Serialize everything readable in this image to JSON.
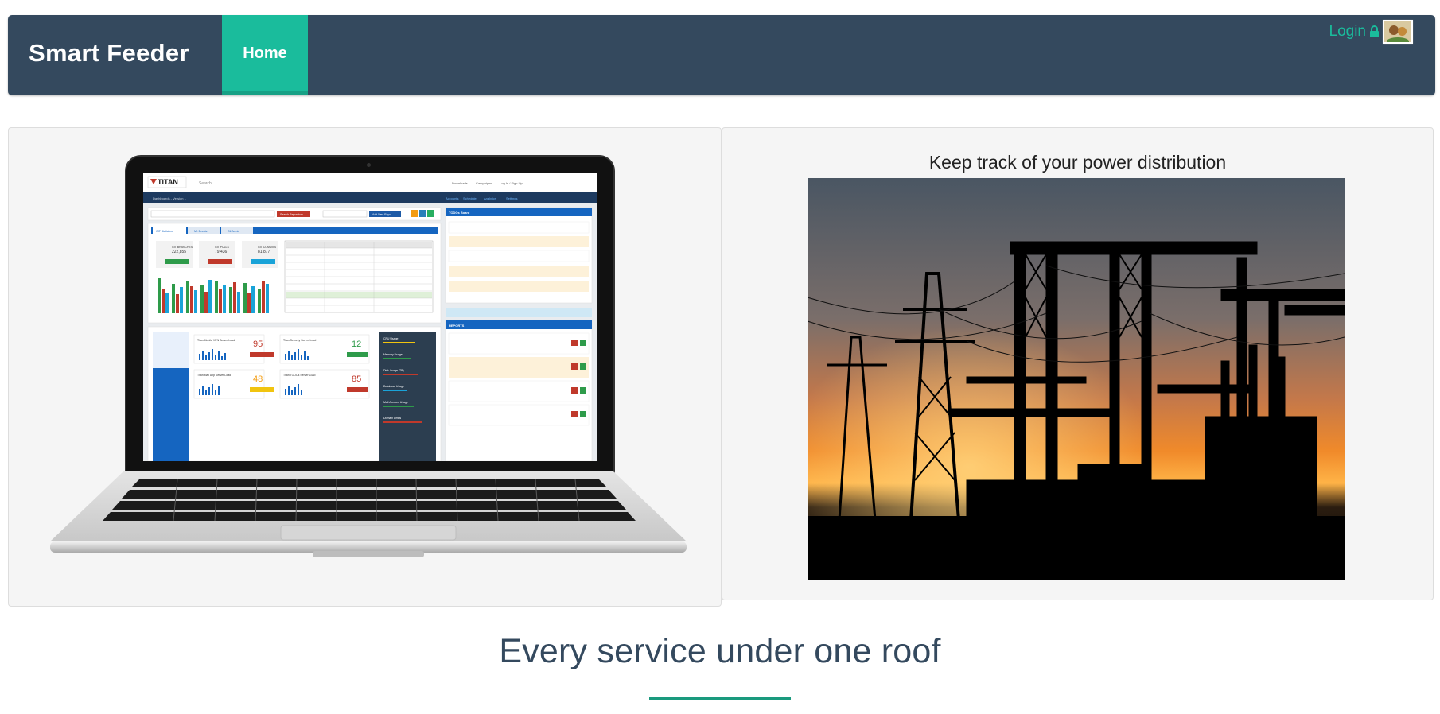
{
  "navbar": {
    "brand": "Smart Feeder",
    "home_label": "Home",
    "login_label": "Login"
  },
  "left_panel": {
    "screenshot": {
      "app_name": "TITAN",
      "search": "Search",
      "header_links": [
        "Downloads",
        "Campaigns",
        "Log In / Sign Up"
      ],
      "breadcrumb": "Dashboards - Version 1",
      "nav_links": [
        "Accounts",
        "Schedule",
        "Analytics",
        "Settings"
      ],
      "buttons": [
        "Search Repository",
        "Add New Repo",
        "Add"
      ],
      "tabs": [
        "GIT Statistics",
        "My Events",
        "Git Admin"
      ],
      "stats": [
        {
          "label": "GIT BRANCHES",
          "value": "222,855"
        },
        {
          "label": "GIT PULLS",
          "value": "79,436"
        },
        {
          "label": "GIT COMMITS",
          "value": "81,877"
        }
      ],
      "gauges": [
        {
          "label": "Titan Mobile VPN Server Load",
          "value": "95"
        },
        {
          "label": "Titan Security Server Load",
          "value": "12"
        },
        {
          "label": "Titan Mail App Server Load",
          "value": "48"
        },
        {
          "label": "Titan TODOs Server Load",
          "value": "85"
        }
      ],
      "panel_titles": [
        "TODOs Board",
        "REPORTS"
      ],
      "usage": [
        "CPU Usage",
        "Memory Usage",
        "Disk Usage (TB)",
        "Database Usage",
        "Mail Account Usage",
        "Domain Limits"
      ]
    }
  },
  "right_panel": {
    "title": "Keep track of your power distribution"
  },
  "tagline": "Every service under one roof",
  "colors": {
    "navbar": "#34495e",
    "accent": "#1abc9c",
    "panel_bg": "#f5f5f5"
  },
  "icons": [
    "lock-icon",
    "avatar-icon"
  ]
}
